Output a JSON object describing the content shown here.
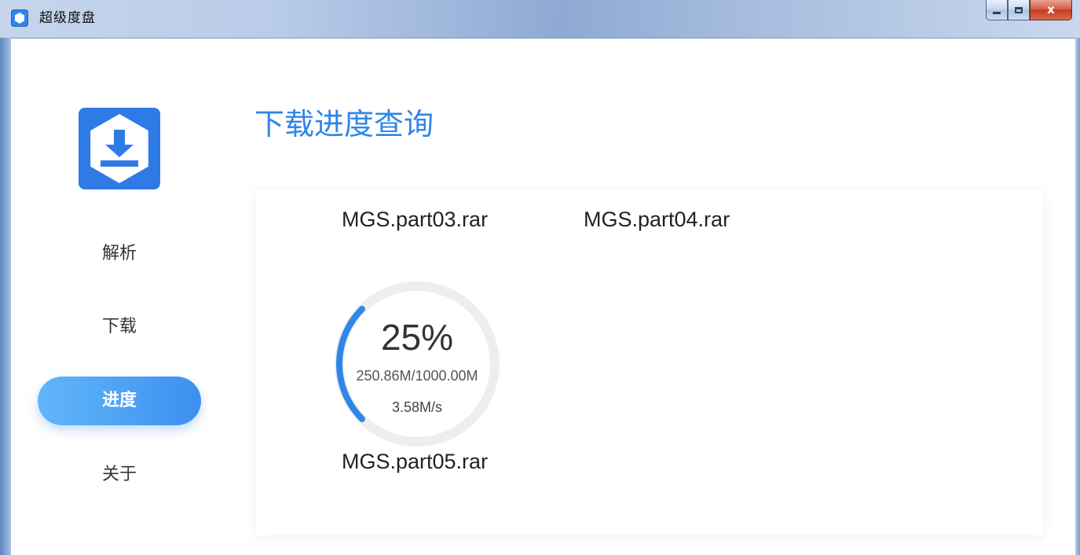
{
  "window": {
    "title": "超级度盘",
    "close_label": "x"
  },
  "sidebar": {
    "items": [
      {
        "label": "解析",
        "active": false
      },
      {
        "label": "下载",
        "active": false
      },
      {
        "label": "进度",
        "active": true
      },
      {
        "label": "关于",
        "active": false
      }
    ]
  },
  "main": {
    "page_title": "下载进度查询",
    "files": [
      {
        "name": "MGS.part03.rar"
      },
      {
        "name": "MGS.part04.rar"
      },
      {
        "name": "MGS.part05.rar",
        "progress_percent": "25%",
        "progress_fraction": 0.25,
        "size": "250.86M/1000.00M",
        "speed": "3.58M/s"
      }
    ]
  },
  "colors": {
    "accent": "#2f86e8",
    "active_nav_start": "#61b7f8",
    "active_nav_end": "#3d8ff0",
    "ring_track": "#eeeeee",
    "ring_progress": "#2f86e8"
  }
}
